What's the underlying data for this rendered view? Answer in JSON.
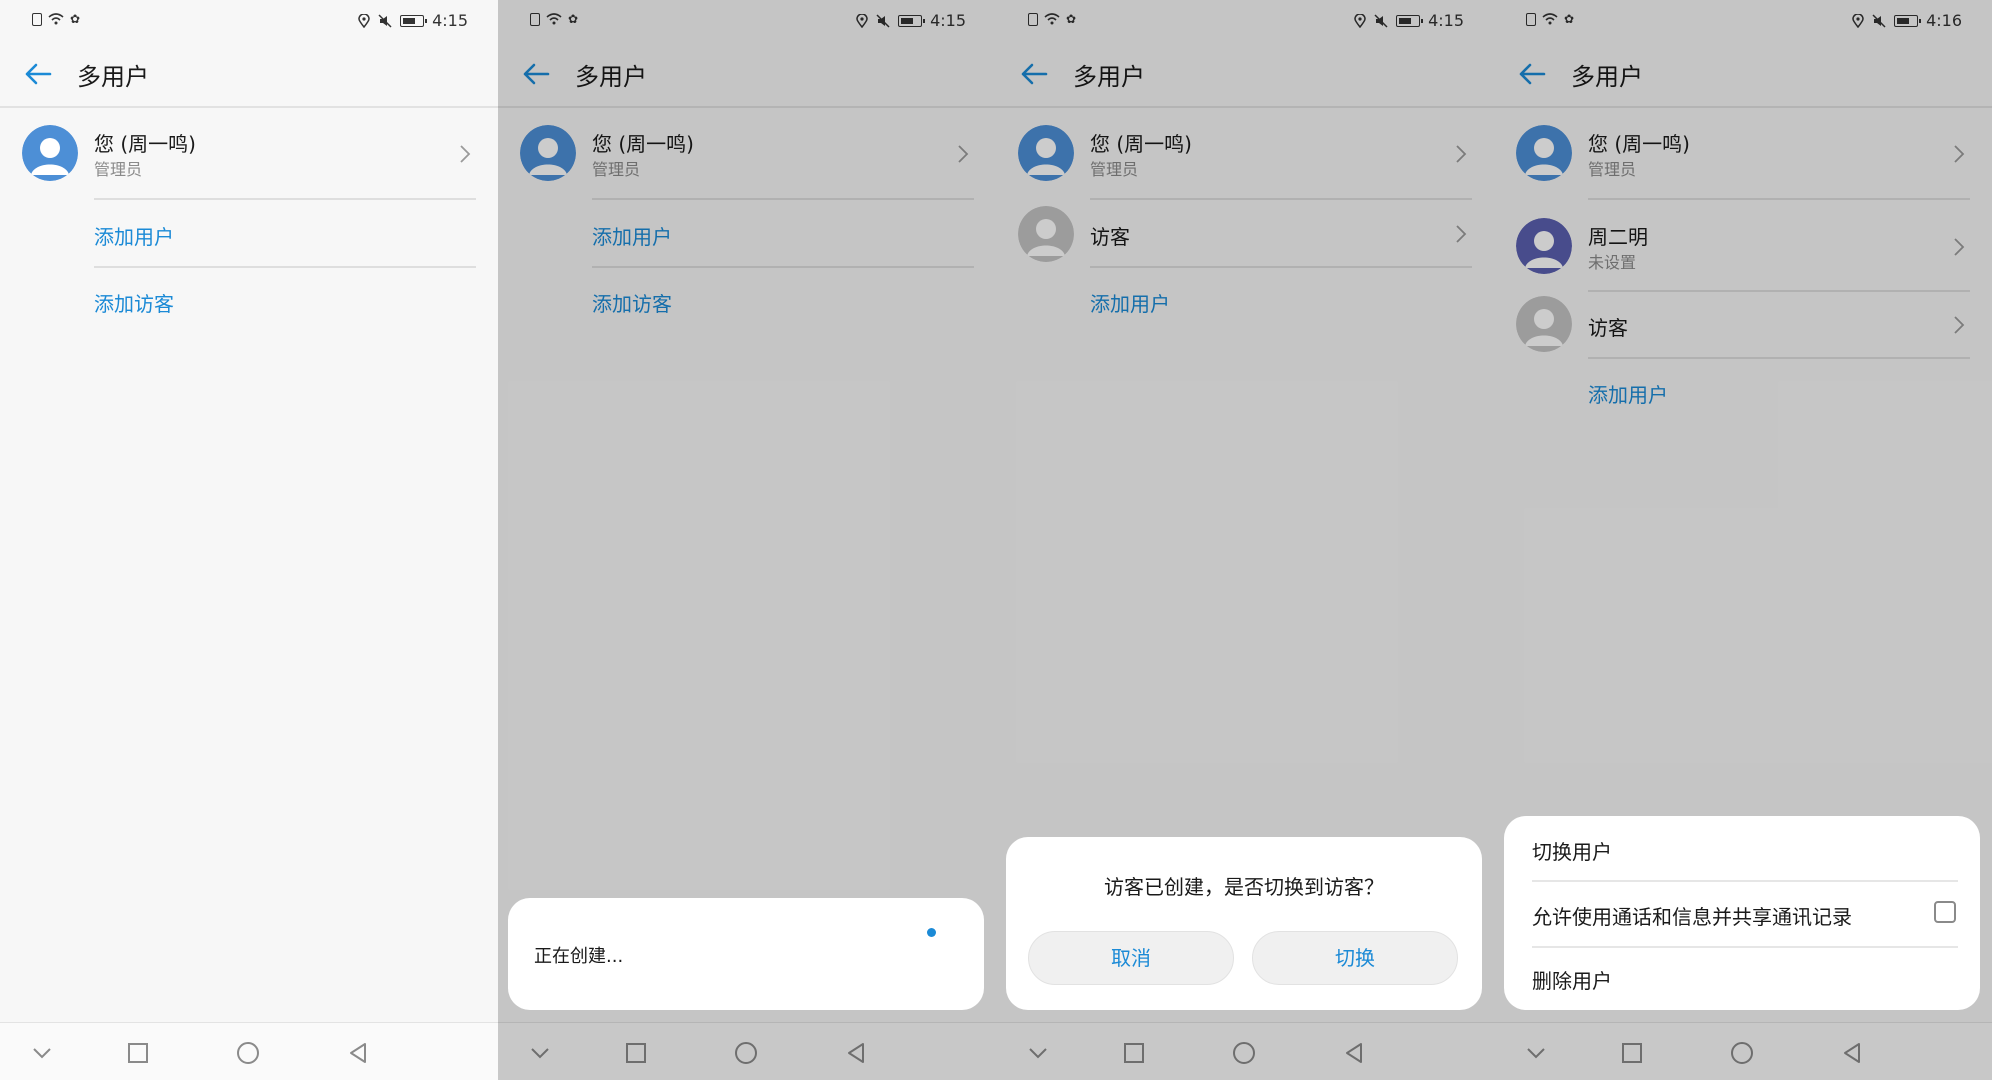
{
  "screens": [
    {
      "statusbar": {
        "time": "4:15"
      },
      "header": {
        "title": "多用户"
      },
      "rows": [
        {
          "title": "您 (周一鸣)",
          "subtitle": "管理员"
        }
      ],
      "links": [
        "添加用户",
        "添加访客"
      ]
    },
    {
      "statusbar": {
        "time": "4:15"
      },
      "header": {
        "title": "多用户"
      },
      "rows": [
        {
          "title": "您 (周一鸣)",
          "subtitle": "管理员"
        }
      ],
      "links": [
        "添加用户",
        "添加访客"
      ],
      "progress": {
        "text": "正在创建..."
      }
    },
    {
      "statusbar": {
        "time": "4:15"
      },
      "header": {
        "title": "多用户"
      },
      "rows": [
        {
          "title": "您 (周一鸣)",
          "subtitle": "管理员"
        },
        {
          "title": "访客"
        }
      ],
      "links": [
        "添加用户"
      ],
      "dialog": {
        "message": "访客已创建，是否切换到访客？",
        "cancel": "取消",
        "confirm": "切换"
      }
    },
    {
      "statusbar": {
        "time": "4:16"
      },
      "header": {
        "title": "多用户"
      },
      "rows": [
        {
          "title": "您 (周一鸣)",
          "subtitle": "管理员"
        },
        {
          "title": "周二明",
          "subtitle": "未设置"
        },
        {
          "title": "访客"
        }
      ],
      "links": [
        "添加用户"
      ],
      "menu": {
        "items": [
          "切换用户",
          "允许使用通话和信息并共享通讯记录",
          "删除用户"
        ],
        "checkbox_checked": false
      }
    }
  ],
  "colors": {
    "accent": "#1b8ad6",
    "admin_avatar": "#4d8fd6",
    "user_avatar": "#5a5fb0",
    "guest_avatar": "#c4c4c4"
  }
}
